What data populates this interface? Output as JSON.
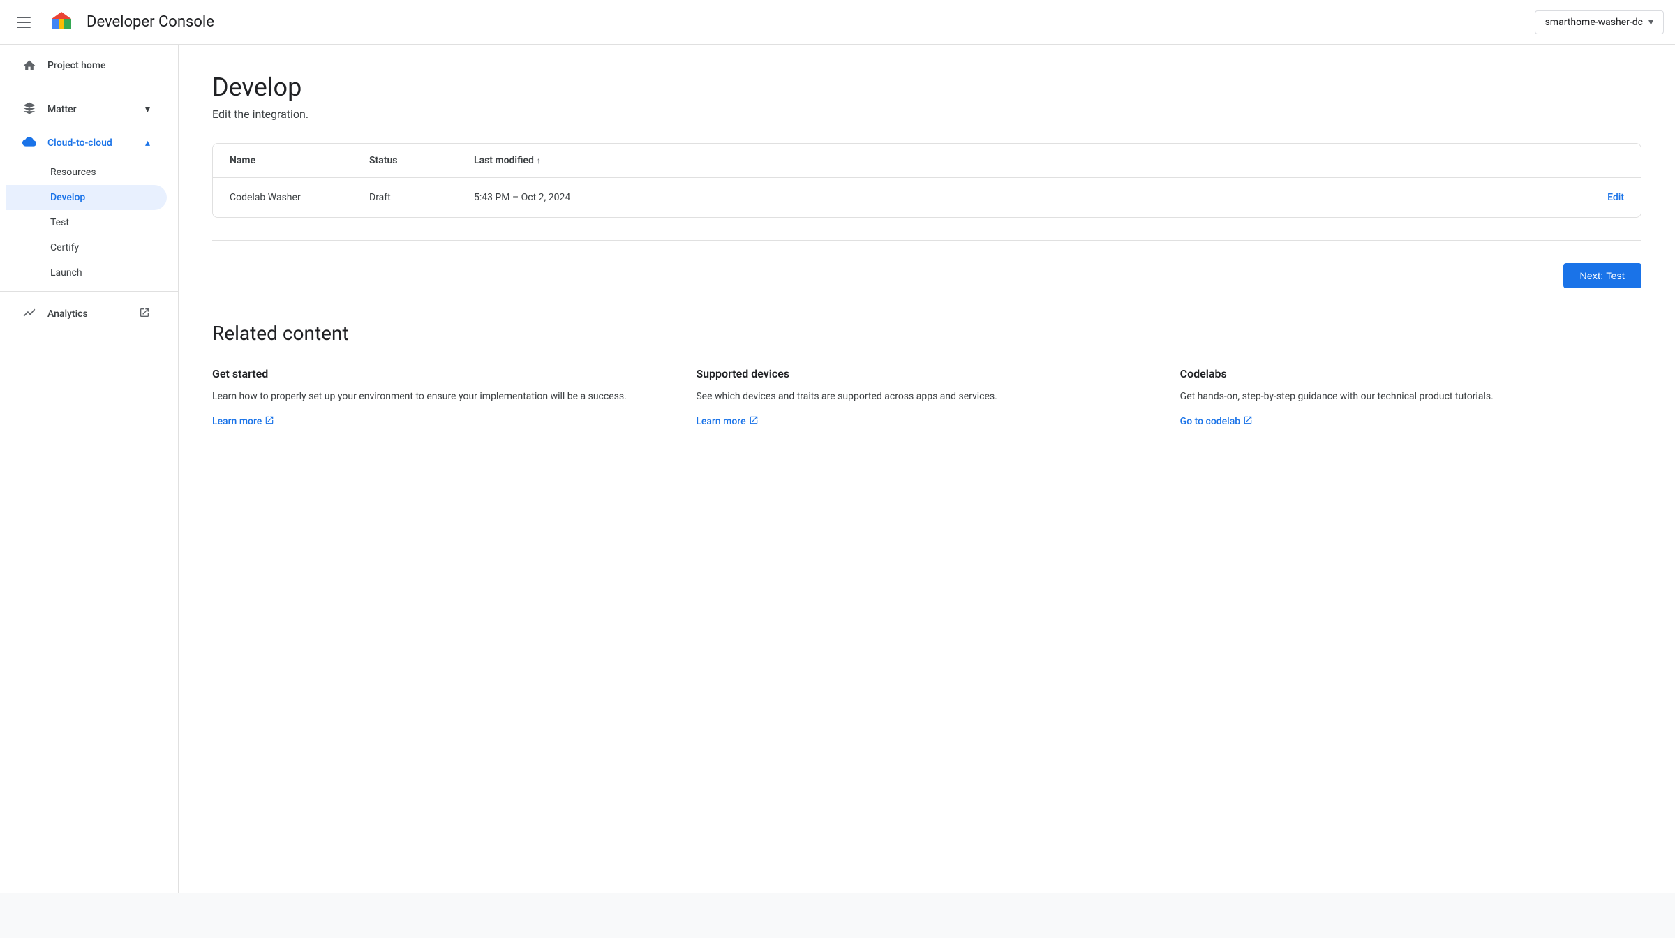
{
  "header": {
    "menu_label": "Menu",
    "title": "Developer Console",
    "project_selector": {
      "value": "smarthome-washer-dc",
      "chevron": "▾"
    }
  },
  "sidebar": {
    "project_home": "Project home",
    "matter": {
      "label": "Matter",
      "chevron_down": "▾"
    },
    "cloud_to_cloud": {
      "label": "Cloud-to-cloud",
      "chevron_up": "▴",
      "children": [
        {
          "label": "Resources",
          "active": false
        },
        {
          "label": "Develop",
          "active": true
        },
        {
          "label": "Test",
          "active": false
        },
        {
          "label": "Certify",
          "active": false
        },
        {
          "label": "Launch",
          "active": false
        }
      ]
    },
    "analytics": {
      "label": "Analytics",
      "external_icon": "⧉"
    }
  },
  "main": {
    "title": "Develop",
    "subtitle": "Edit the integration.",
    "table": {
      "columns": [
        "Name",
        "Status",
        "Last modified",
        ""
      ],
      "sort_arrow": "↑",
      "rows": [
        {
          "name": "Codelab Washer",
          "status": "Draft",
          "last_modified": "5:43 PM – Oct 2, 2024",
          "action": "Edit"
        }
      ]
    },
    "next_button": "Next: Test",
    "related_content": {
      "title": "Related content",
      "cards": [
        {
          "title": "Get started",
          "description": "Learn how to properly set up your environment to ensure your implementation will be a success.",
          "link_label": "Learn more",
          "link_icon": "⧉"
        },
        {
          "title": "Supported devices",
          "description": "See which devices and traits are supported across apps and services.",
          "link_label": "Learn more",
          "link_icon": "⧉"
        },
        {
          "title": "Codelabs",
          "description": "Get hands-on, step-by-step guidance with our technical product tutorials.",
          "link_label": "Go to codelab",
          "link_icon": "⧉"
        }
      ]
    }
  }
}
